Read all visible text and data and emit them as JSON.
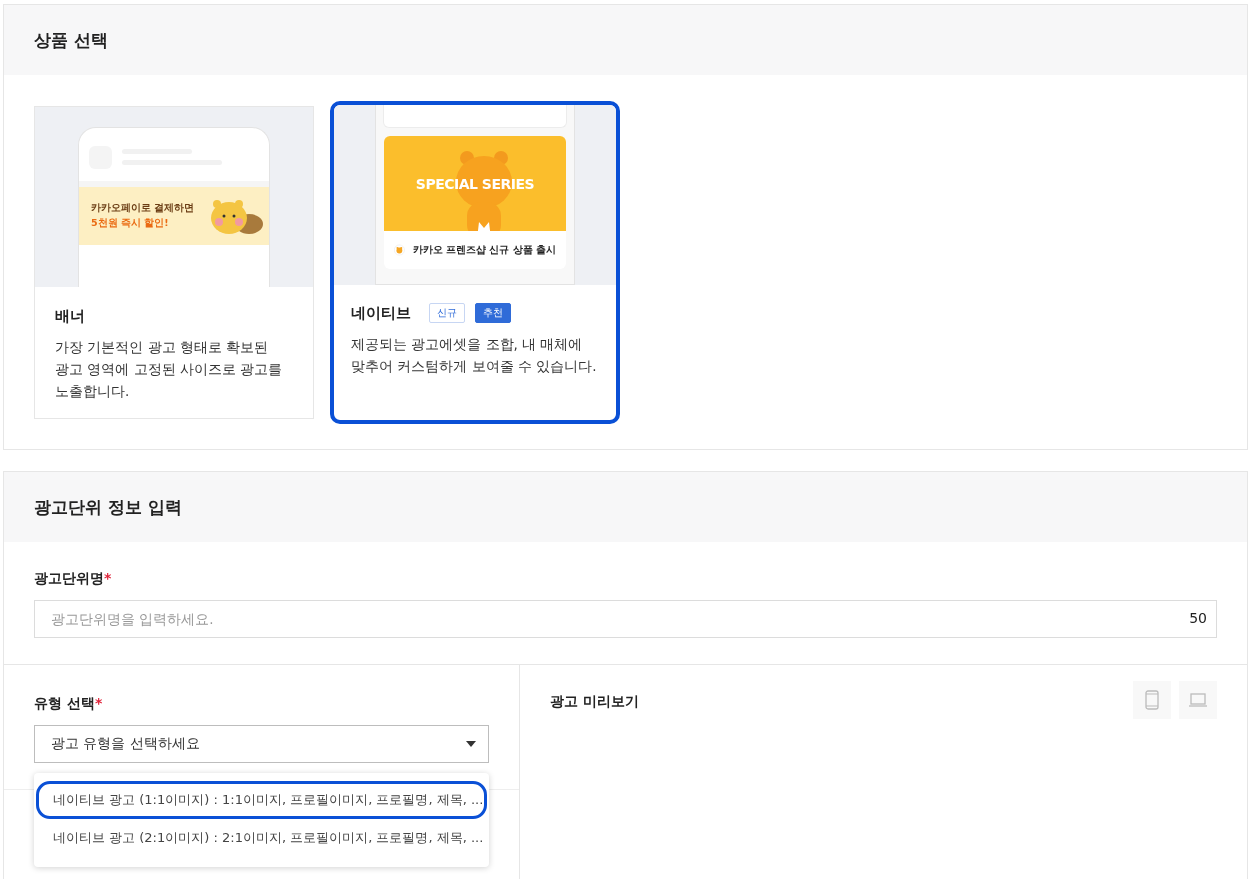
{
  "product_section": {
    "title": "상품 선택",
    "products": [
      {
        "kind": "banner",
        "name": "배너",
        "description": "가장 기본적인 광고 형태로 확보된 광고 영역에 고정된 사이즈로 광고를 노출합니다.",
        "selected": false,
        "art_texts": [
          "카카오페이로 결제하면",
          "5천원 즉시 할인!"
        ]
      },
      {
        "kind": "native",
        "name": "네이티브",
        "badges": [
          {
            "label": "신규",
            "kind": "outline"
          },
          {
            "label": "추천",
            "kind": "filled"
          }
        ],
        "description": "제공되는 광고에셋을 조합, 내 매체에 맞추어 커스텀하게 보여줄 수 있습니다.",
        "selected": true,
        "art_texts": [
          "SPECIAL SERIES",
          "카카오 프렌즈샵 신규 상품 출시"
        ]
      }
    ]
  },
  "unit_section": {
    "title": "광고단위 정보 입력",
    "name_field": {
      "label": "광고단위명",
      "required_mark": "*",
      "placeholder": "광고단위명을 입력하세요.",
      "counter": "50"
    },
    "type_field": {
      "label": "유형 선택",
      "required_mark": "*",
      "placeholder": "광고 유형을 선택하세요",
      "options": [
        {
          "label": "네이티브 광고 (1:1이미지) : 1:1이미지, 프로필이미지, 프로필명, 제목, ...",
          "selected": true
        },
        {
          "label": "네이티브 광고 (2:1이미지) : 2:1이미지, 프로필이미지, 프로필명, 제목, ...",
          "selected": false
        }
      ]
    },
    "preview": {
      "title": "광고 미리보기",
      "devices": [
        {
          "kind": "mobile",
          "selected": false
        },
        {
          "kind": "pc",
          "selected": false
        }
      ]
    }
  }
}
